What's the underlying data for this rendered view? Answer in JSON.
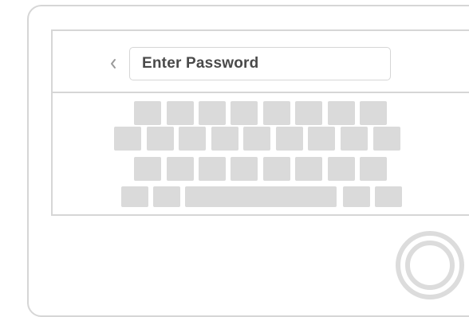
{
  "login": {
    "password_placeholder": "Enter Password"
  },
  "icons": {
    "back": "chevron-left-icon",
    "home": "home-button-icon"
  },
  "colors": {
    "border": "#d6d6d6",
    "key": "#dadada",
    "text": "#4a4a4a",
    "chevron": "#9a9a9a"
  }
}
